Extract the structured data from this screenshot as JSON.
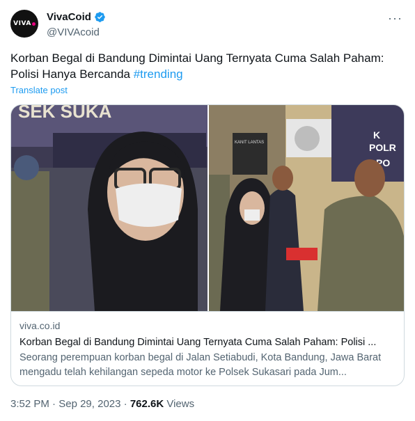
{
  "author": {
    "display_name": "VivaCoid",
    "handle": "@VIVAcoid",
    "avatar_text": "VIVA",
    "verified": true
  },
  "tweet": {
    "text": "Korban Begal di Bandung Dimintai Uang Ternyata Cuma Salah Paham: Polisi Hanya Bercanda ",
    "hashtag": "#trending",
    "translate_label": "Translate post"
  },
  "card": {
    "domain": "viva.co.id",
    "title": "Korban Begal di Bandung Dimintai Uang Ternyata Cuma Salah Paham: Polisi ...",
    "description": "Seorang perempuan korban begal di Jalan Setiabudi, Kota Bandung, Jawa Barat mengadu telah kehilangan sepeda motor ke Polsek Sukasari pada Jum...",
    "image_banner_left": "SEK SUKA",
    "image_banner_right_1": "K",
    "image_banner_right_2": "POLR",
    "image_banner_right_3": "PO",
    "image_wall_sign": "KANIT LANTAS"
  },
  "meta": {
    "time": "3:52 PM",
    "separator": "·",
    "date": "Sep 29, 2023",
    "views_count": "762.6K",
    "views_label": "Views"
  },
  "colors": {
    "accent": "#1d9bf0",
    "text": "#0f1419",
    "secondary": "#536471",
    "border": "#cfd9de"
  }
}
